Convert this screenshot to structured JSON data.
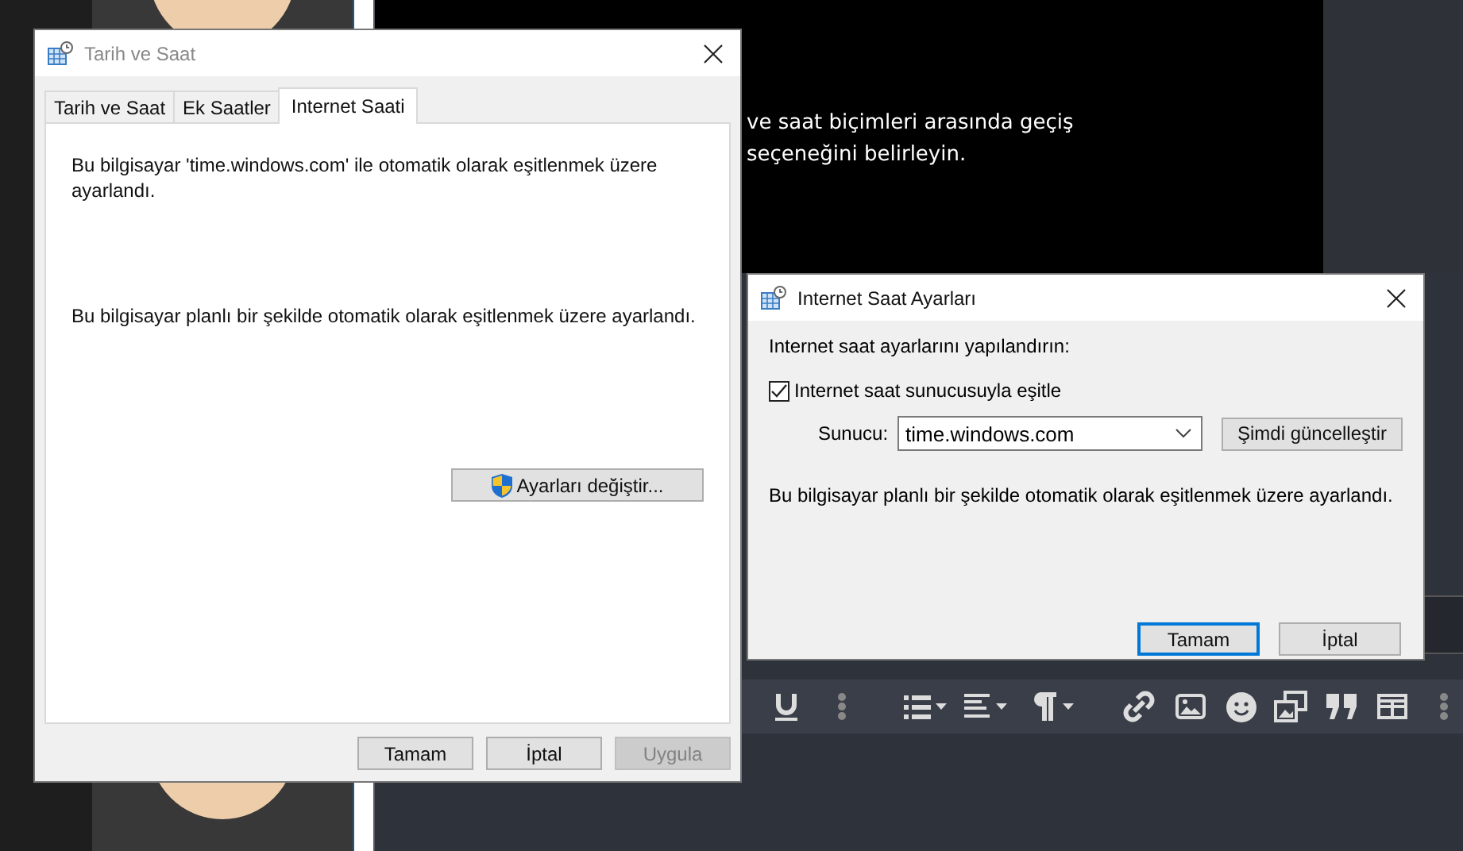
{
  "background": {
    "notice_lines": [
      "ve saat biçimleri arasında geçiş",
      "seçeneğini belirleyin."
    ]
  },
  "date_time_dialog": {
    "title": "Tarih ve Saat",
    "tabs": [
      {
        "label": "Tarih ve Saat",
        "selected": false
      },
      {
        "label": "Ek Saatler",
        "selected": false
      },
      {
        "label": "Internet Saati",
        "selected": true
      }
    ],
    "sync_text": "Bu bilgisayar 'time.windows.com' ile otomatik olarak eşitlenmek üzere ayarlandı.",
    "schedule_text": "Bu bilgisayar planlı bir şekilde otomatik olarak eşitlenmek üzere ayarlandı.",
    "change_button": "Ayarları değiştir...",
    "buttons": [
      {
        "label": "Tamam",
        "disabled": false
      },
      {
        "label": "İptal",
        "disabled": false
      },
      {
        "label": "Uygula",
        "disabled": true
      }
    ]
  },
  "internet_time_dialog": {
    "title": "Internet Saat Ayarları",
    "heading": "Internet saat ayarlarını yapılandırın:",
    "sync_checkbox": {
      "label": "Internet saat sunucusuyla eşitle",
      "checked": true
    },
    "server_label": "Sunucu:",
    "server_value": "time.windows.com",
    "update_button": "Şimdi güncelleştir",
    "schedule_text": "Bu bilgisayar planlı bir şekilde otomatik olarak eşitlenmek üzere ayarlandı.",
    "buttons": [
      {
        "label": "Tamam",
        "focused": true
      },
      {
        "label": "İptal",
        "focused": false
      }
    ]
  }
}
